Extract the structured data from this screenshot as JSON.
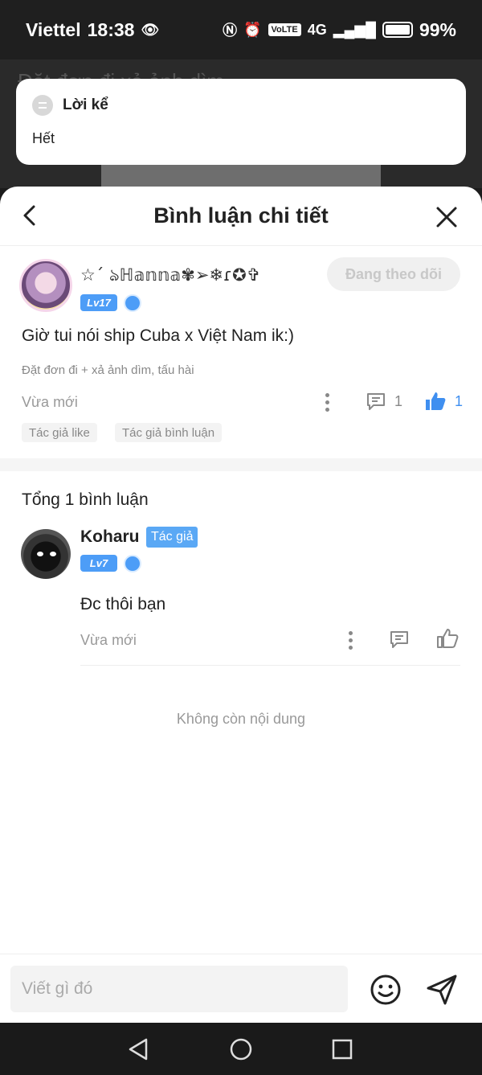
{
  "status": {
    "carrier": "Viettel",
    "time": "18:38",
    "network_badge": "VoLTE",
    "network_type": "4G",
    "battery": "99%"
  },
  "background": {
    "title": "Đặt đơn đi xả ảnh dìm..."
  },
  "notification": {
    "title": "Lời kể",
    "body": "Hết"
  },
  "sheet": {
    "title": "Bình luận chi tiết"
  },
  "post": {
    "user_name": "☆ˊ ঌℍ𝕒𝕟𝕟𝕒✾➢❄ɾ✪✞",
    "level": "Lv17",
    "follow_label": "Đang theo dõi",
    "text": "Giờ tui nói ship Cuba x Việt Nam ik:)",
    "subtitle": "Đặt đơn đi + xả ảnh dìm, tấu hài",
    "time": "Vừa mới",
    "comment_count": "1",
    "like_count": "1",
    "tags": [
      "Tác giả like",
      "Tác giả bình luận"
    ]
  },
  "comments": {
    "total_label": "Tổng 1 bình luận",
    "items": [
      {
        "name": "Koharu",
        "author_tag": "Tác giả",
        "level": "Lv7",
        "text": "Đc thôi bạn",
        "time": "Vừa mới"
      }
    ],
    "end_label": "Không còn nội dung"
  },
  "input": {
    "placeholder": "Viết gì đó"
  },
  "colors": {
    "accent": "#4d9df7",
    "like_active": "#3f8ff0",
    "muted": "#999999"
  }
}
